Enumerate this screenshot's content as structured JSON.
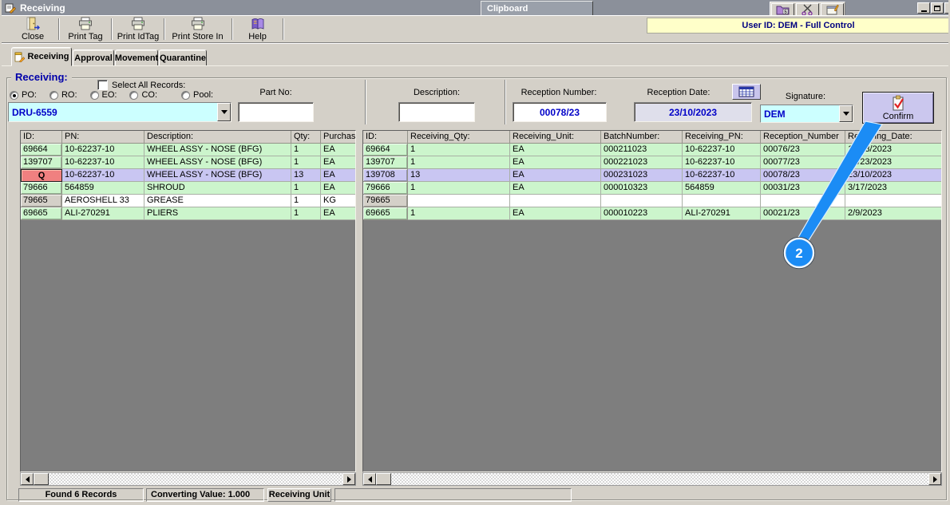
{
  "window": {
    "title": "Receiving"
  },
  "floating": {
    "clipboard_title": "Clipboard"
  },
  "toolbar": {
    "buttons": [
      {
        "icon": "close-door-icon",
        "label": "Close"
      },
      {
        "icon": "printer-icon",
        "label": "Print Tag"
      },
      {
        "icon": "printer-icon",
        "label": "Print IdTag"
      },
      {
        "icon": "printer-icon",
        "label": "Print Store In"
      },
      {
        "icon": "help-book-icon",
        "label": "Help"
      }
    ]
  },
  "user_banner": {
    "text": "User ID: DEM - Full Control"
  },
  "tabs": [
    {
      "label": "Receiving",
      "active": true
    },
    {
      "label": "Approval",
      "active": false
    },
    {
      "label": "Movement",
      "active": false
    },
    {
      "label": "Quarantine",
      "active": false
    }
  ],
  "receiving_panel": {
    "group_title": "Receiving:",
    "select_all_label": "Select All Records:",
    "order_types": [
      {
        "label": "PO:",
        "selected": true
      },
      {
        "label": "RO:",
        "selected": false
      },
      {
        "label": "EO:",
        "selected": false
      },
      {
        "label": "CO:",
        "selected": false
      },
      {
        "label": "Pool:",
        "selected": false
      }
    ],
    "order_combo": {
      "value": "DRU-6559"
    },
    "part_no": {
      "label": "Part No:",
      "value": ""
    },
    "description": {
      "label": "Description:",
      "value": ""
    },
    "reception_number": {
      "label": "Reception Number:",
      "value": "00078/23"
    },
    "reception_date": {
      "label": "Reception Date:",
      "value": "23/10/2023"
    },
    "signature": {
      "label": "Signature:",
      "value": "DEM"
    },
    "confirm_button": {
      "label": "Confirm"
    }
  },
  "left_table": {
    "headers": [
      "ID:",
      "PN:",
      "Description:",
      "Qty:",
      "Purchas"
    ],
    "rows": [
      {
        "cells": [
          "69664",
          "10-62237-10",
          "WHEEL ASSY - NOSE (BFG)",
          "1",
          "EA"
        ],
        "bg": "green"
      },
      {
        "cells": [
          "139707",
          "10-62237-10",
          "WHEEL ASSY - NOSE (BFG)",
          "1",
          "EA"
        ],
        "bg": "green"
      },
      {
        "cells": [
          "Q",
          "10-62237-10",
          "WHEEL ASSY - NOSE (BFG)",
          "13",
          "EA"
        ],
        "bg": "selected",
        "id_type": "q-button"
      },
      {
        "cells": [
          "79666",
          "564859",
          "SHROUD",
          "1",
          "EA"
        ],
        "bg": "green"
      },
      {
        "cells": [
          "79665",
          "AEROSHELL 33",
          "GREASE",
          "1",
          "KG"
        ],
        "bg": "white"
      },
      {
        "cells": [
          "69665",
          "ALI-270291",
          "PLIERS",
          "1",
          "EA"
        ],
        "bg": "green"
      }
    ]
  },
  "right_table": {
    "headers": [
      "ID:",
      "Receiving_Qty:",
      "Receiving_Unit:",
      "BatchNumber:",
      "Receiving_PN:",
      "Reception_Number",
      "Receiving_Date:"
    ],
    "rows": [
      {
        "cells": [
          "69664",
          "1",
          "EA",
          "000211023",
          "10-62237-10",
          "00076/23",
          "10/23/2023"
        ],
        "bg": "green"
      },
      {
        "cells": [
          "139707",
          "1",
          "EA",
          "000221023",
          "10-62237-10",
          "00077/23",
          "10/23/2023"
        ],
        "bg": "green"
      },
      {
        "cells": [
          "139708",
          "13",
          "EA",
          "000231023",
          "10-62237-10",
          "00078/23",
          "23/10/2023"
        ],
        "bg": "selected"
      },
      {
        "cells": [
          "79666",
          "1",
          "EA",
          "000010323",
          "564859",
          "00031/23",
          "3/17/2023"
        ],
        "bg": "green"
      },
      {
        "cells": [
          "79665",
          "",
          "",
          "",
          "",
          "",
          ""
        ],
        "bg": "white"
      },
      {
        "cells": [
          "69665",
          "1",
          "EA",
          "000010223",
          "ALI-270291",
          "00021/23",
          "2/9/2023"
        ],
        "bg": "green"
      }
    ]
  },
  "status_bar": {
    "found": "Found 6 Records",
    "converting": "Converting Value: 1.000",
    "unit": "Receiving Unit"
  },
  "callout": {
    "number": "2"
  },
  "colors": {
    "titlebar": "#8b909a",
    "banner_bg": "#ffffc9",
    "combo_bg": "#ccffff",
    "value_text": "#0000c8",
    "row_green": "#ccf5cc",
    "row_selected": "#c9c6f2",
    "q_button": "#f08080",
    "callout_blue": "#1b8cf5"
  }
}
